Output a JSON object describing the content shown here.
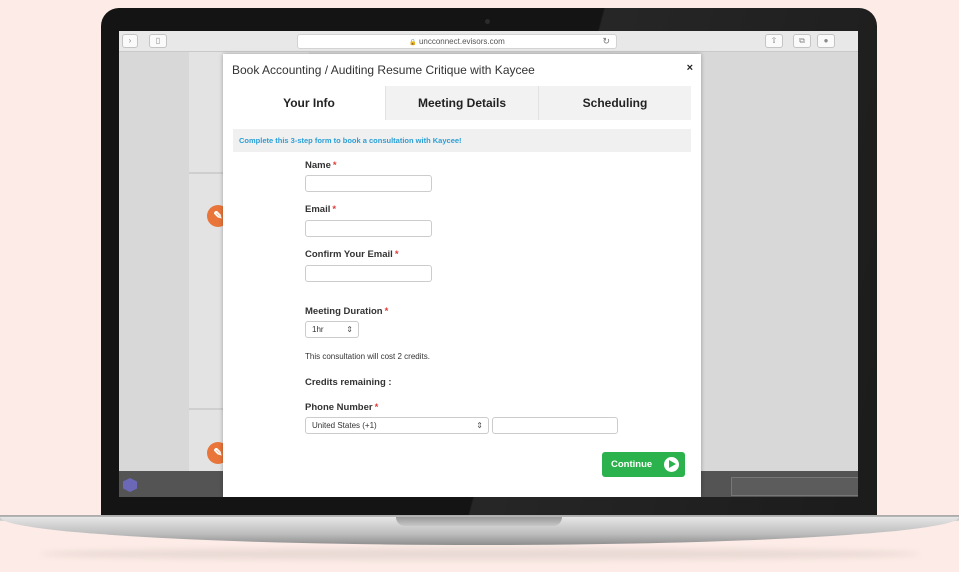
{
  "browser": {
    "url": "uncconnect.evisors.com",
    "lock_glyph": "🔒"
  },
  "modal": {
    "title": "Book Accounting / Auditing Resume Critique with Kaycee",
    "close_glyph": "×",
    "tabs": [
      {
        "label": "Your Info",
        "active": true
      },
      {
        "label": "Meeting Details",
        "active": false
      },
      {
        "label": "Scheduling",
        "active": false
      }
    ],
    "banner": "Complete this 3-step form to book a consultation with Kaycee!"
  },
  "form": {
    "name_label": "Name",
    "email_label": "Email",
    "confirm_email_label": "Confirm Your Email",
    "duration_label": "Meeting Duration",
    "duration_value": "1hr",
    "cost_text": "This consultation will cost 2 credits.",
    "credits_label": "Credits remaining :",
    "phone_label": "Phone Number",
    "country_value": "United States (+1)",
    "required_mark": "*",
    "continue_label": "Continue"
  },
  "colors": {
    "accent_blue": "#2a9fd6",
    "required_red": "#e23b3b",
    "continue_green": "#2bb24c",
    "avatar_orange": "#e9753a"
  }
}
